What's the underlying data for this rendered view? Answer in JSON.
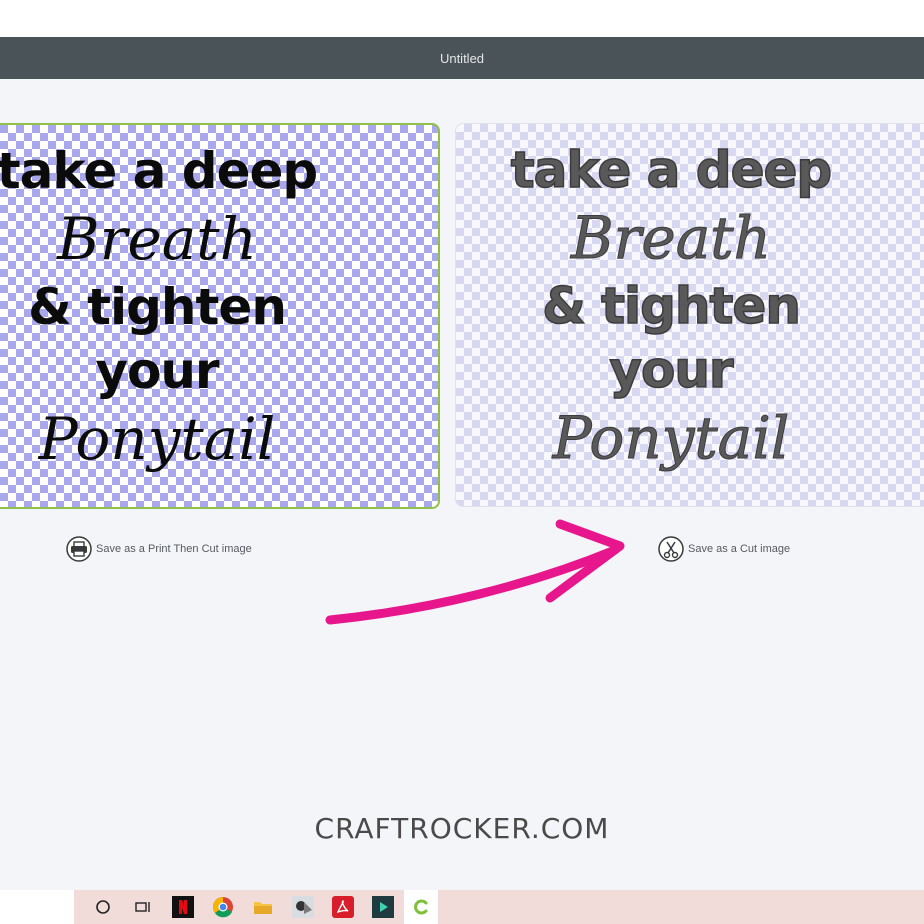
{
  "window": {
    "title": "Untitled"
  },
  "quote": {
    "line1": "take a deep",
    "line2": "Breath",
    "line3": "& tighten",
    "line4": "your",
    "line5": "Ponytail"
  },
  "options": {
    "print_cut_label": "Save as a Print Then Cut image",
    "cut_label": "Save as a Cut image"
  },
  "watermark": "CRAFTROCKER.COM",
  "colors": {
    "titlebar": "#4a5358",
    "selected_border": "#8fc148",
    "arrow": "#e8168c"
  },
  "taskbar": {
    "icons": [
      "cortana-icon",
      "task-view-icon",
      "netflix-icon",
      "chrome-icon",
      "file-explorer-icon",
      "photo-app-icon",
      "acrobat-icon",
      "media-app-icon",
      "cricut-icon"
    ]
  }
}
